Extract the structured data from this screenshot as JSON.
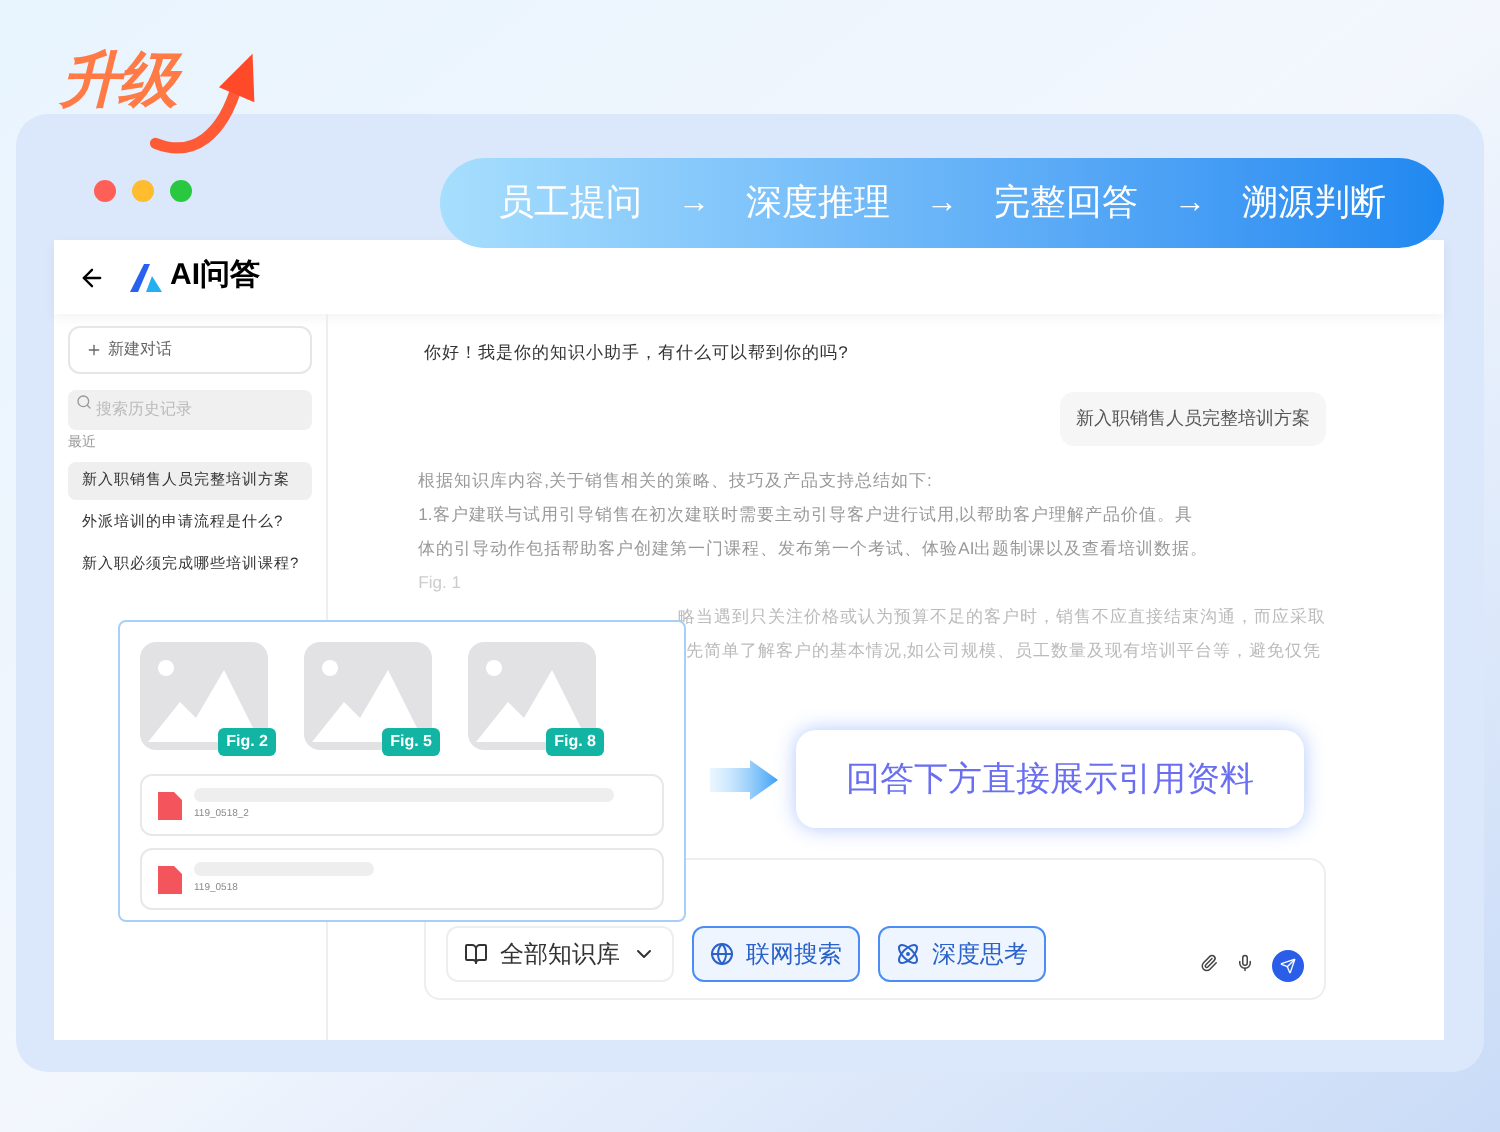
{
  "badge": {
    "text": "升级"
  },
  "pipeline": [
    {
      "kind": "step",
      "text": "员工提问"
    },
    {
      "kind": "arrow",
      "text": "→"
    },
    {
      "kind": "step",
      "text": "深度推理"
    },
    {
      "kind": "arrow",
      "text": "→"
    },
    {
      "kind": "step",
      "text": "完整回答"
    },
    {
      "kind": "arrow",
      "text": "→"
    },
    {
      "kind": "step",
      "text": "溯源判断"
    }
  ],
  "window": {
    "title": "AI问答"
  },
  "sidebar": {
    "new_chat": "新建对话",
    "search": {
      "placeholder": "搜索历史记录"
    },
    "section": "最近",
    "items": [
      {
        "label": "新入职销售人员完整培训方案",
        "selected": true
      },
      {
        "label": "外派培训的申请流程是什么?",
        "selected": false
      },
      {
        "label": "新入职必须完成哪些培训课程?",
        "selected": false
      }
    ]
  },
  "chat": {
    "greeting": "你好！我是你的知识小助手，有什么可以帮到你的吗?",
    "user_message": "新入职销售人员完整培训方案",
    "answer": [
      "根据知识库内容,关于销售相关的策略、技巧及产品支持总结如下:",
      "1.客户建联与试用引导销售在初次建联时需要主动引导客户进行试用,以帮助客户理解产品价值。具",
      "体的引导动作包括帮助客户创建第一门课程、发布第一个考试、体验AI出题制课以及查看培训数据。"
    ],
    "figure": "Fig. 1",
    "answer_partial": [
      "略当遇到只关注价格或认为预算不足的客户时，销售不应直接结束沟通，而应采取",
      "先简单了解客户的基本情况,如公司规模、员工数量及现有培训平台等，避免仅凭"
    ]
  },
  "references": {
    "figures": [
      "Fig. 2",
      "Fig. 5",
      "Fig. 8"
    ],
    "files": [
      {
        "name": "119_0518_2"
      },
      {
        "name": "119_0518"
      }
    ]
  },
  "callout": "回答下方直接展示引用资料",
  "composer": {
    "knowledge_base": "全部知识库",
    "toggles": [
      {
        "kind": "web",
        "label": "联网搜索",
        "on": true
      },
      {
        "kind": "think",
        "label": "深度思考",
        "on": true
      }
    ]
  }
}
